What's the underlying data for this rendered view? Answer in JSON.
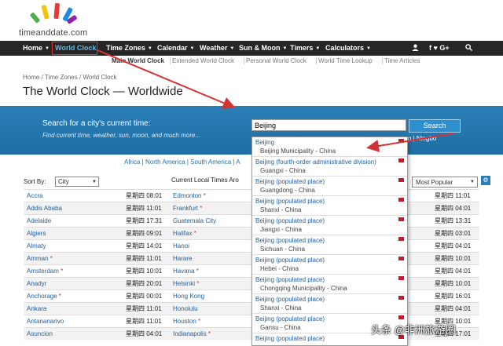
{
  "logo": {
    "text": "timeanddate.com"
  },
  "nav": {
    "items": [
      {
        "label": "Home",
        "caret": true
      },
      {
        "label": "World Clock",
        "caret": false
      },
      {
        "label": "Time Zones",
        "caret": true
      },
      {
        "label": "Calendar",
        "caret": true
      },
      {
        "label": "Weather",
        "caret": true
      },
      {
        "label": "Sun & Moon",
        "caret": true
      },
      {
        "label": "Timers",
        "caret": true
      },
      {
        "label": "Calculators",
        "caret": true
      }
    ],
    "social": "f ♥ G+"
  },
  "subnav": [
    "Main World Clock",
    "Extended World Clock",
    "Personal World Clock",
    "World Time Lookup",
    "Time Articles"
  ],
  "breadcrumb": "Home /  Time Zones /  World Clock",
  "page_title": "The World Clock — Worldwide",
  "search": {
    "label": "Search for a city's current time:",
    "subtitle": "Find current time, weather, sun, moon, and much more...",
    "value": "Beijing",
    "button": "Search",
    "right_text": "ong | Ningbo"
  },
  "regions": "Africa | North America | South America | A",
  "table": {
    "sort_label": "Sort By:",
    "sort_value": "City",
    "header": "Current Local Times Aro",
    "popular": "Most Popular",
    "rows": [
      {
        "c1": "Accra",
        "s1": false,
        "t1": "星期四 08:01",
        "c2": "Edmonton",
        "s2": true,
        "t3": "星期四 11:01"
      },
      {
        "c1": "Addis Ababa",
        "s1": false,
        "t1": "星期四 11:01",
        "c2": "Frankfurt",
        "s2": true,
        "t3": "星期四 04:01"
      },
      {
        "c1": "Adelaide",
        "s1": false,
        "t1": "星期四 17:31",
        "c2": "Guatemala City",
        "s2": false,
        "t3": "星期四 13:31"
      },
      {
        "c1": "Algiers",
        "s1": false,
        "t1": "星期四 09:01",
        "c2": "Halifax",
        "s2": true,
        "t3": "星期四 03:01"
      },
      {
        "c1": "Almaty",
        "s1": false,
        "t1": "星期四 14:01",
        "c2": "Hanoi",
        "s2": false,
        "t3": "星期四 04:01"
      },
      {
        "c1": "Amman",
        "s1": true,
        "t1": "星期四 11:01",
        "c2": "Harare",
        "s2": false,
        "t3": "星期四 10:01"
      },
      {
        "c1": "Amsterdam",
        "s1": true,
        "t1": "星期四 10:01",
        "c2": "Havana",
        "s2": true,
        "t3": "星期四 04:01"
      },
      {
        "c1": "Anadyr",
        "s1": false,
        "t1": "星期四 20:01",
        "c2": "Helsinki",
        "s2": true,
        "t3": "星期四 10:01"
      },
      {
        "c1": "Anchorage",
        "s1": true,
        "t1": "星期四 00:01",
        "c2": "Hong Kong",
        "s2": false,
        "t3": "星期四 16:01"
      },
      {
        "c1": "Ankara",
        "s1": false,
        "t1": "星期四 11:01",
        "c2": "Honolulu",
        "s2": false,
        "t3": "星期四 04:01"
      },
      {
        "c1": "Antananarivo",
        "s1": false,
        "t1": "星期四 11:01",
        "c2": "Houston",
        "s2": true,
        "t3": "星期四 10:01"
      },
      {
        "c1": "Asuncion",
        "s1": false,
        "t1": "星期四 04:01",
        "c2": "Indianapolis",
        "s2": true,
        "t3": "星期四 17:01"
      }
    ]
  },
  "dropdown": [
    {
      "name": "Beijing",
      "detail": "Beijing Municipality - China"
    },
    {
      "name": "Beijing (fourth-order administrative division)",
      "detail": "Guangxi - China"
    },
    {
      "name": "Beijing (populated place)",
      "detail": "Guangdong - China"
    },
    {
      "name": "Beijing (populated place)",
      "detail": "Shanxi - China"
    },
    {
      "name": "Beijing (populated place)",
      "detail": "Jiangxi - China"
    },
    {
      "name": "Beijing (populated place)",
      "detail": "Sichuan - China"
    },
    {
      "name": "Beijing (populated place)",
      "detail": "Hebei - China"
    },
    {
      "name": "Beijing (populated place)",
      "detail": "Chongqing Municipality - China"
    },
    {
      "name": "Beijing (populated place)",
      "detail": "Shanxi - China"
    },
    {
      "name": "Beijing (populated place)",
      "detail": "Gansu - China"
    },
    {
      "name": "Beijing (populated place)",
      "detail": ""
    }
  ],
  "watermark": "头条 @非洲旅游圈",
  "colors": {
    "nav_bg": "#262626",
    "active": "#5db8ea",
    "band": "#2a7fb6",
    "annotation": "#d33333"
  }
}
